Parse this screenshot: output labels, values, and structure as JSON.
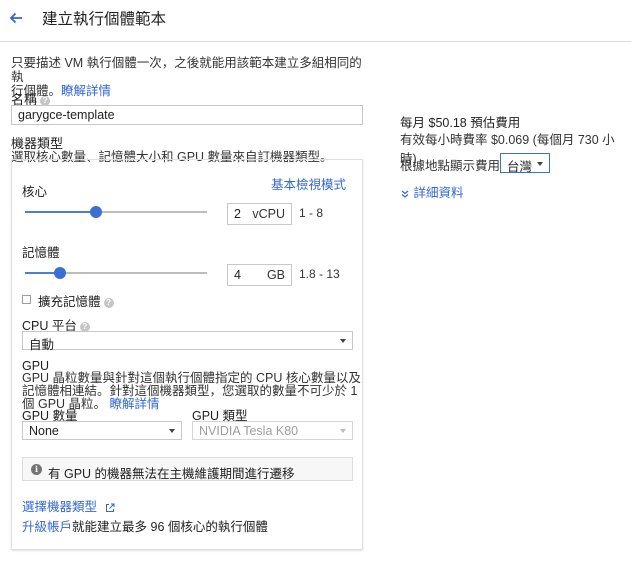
{
  "header": {
    "title": "建立執行個體範本"
  },
  "intro": {
    "text": "只要描述 VM 執行個體一次，之後就能用該範本建立多組相同的執行個體。",
    "text_line1": "只要描述 VM 執行個體一次，之後就能用該範本建立多組相同的執",
    "text_line2": "行個體。",
    "learn_more": "瞭解詳情"
  },
  "name": {
    "label": "名稱",
    "value": "garygce-template"
  },
  "machine_type": {
    "label": "機器類型",
    "description": "選取核心數量、記憶體大小和 GPU 數量來自訂機器類型。",
    "basic_view_link": "基本檢視模式",
    "cores": {
      "label": "核心",
      "value": "2",
      "unit": "vCPU",
      "range": "1 - 8",
      "slider_fraction": 0.39
    },
    "memory": {
      "label": "記憶體",
      "value": "4",
      "unit": "GB",
      "range": "1.8 - 13",
      "slider_fraction": 0.19
    },
    "extended_memory": {
      "label": "擴充記憶體",
      "checked": false
    },
    "cpu_platform": {
      "label": "CPU 平台",
      "selected": "自動"
    },
    "gpu": {
      "heading": "GPU",
      "description_line1": "GPU 晶粒數量與針對這個執行個體指定的 CPU 核心數量以及",
      "description_line2": "記憶體相連結。針對這個機器類型，您選取的數量不可少於 1",
      "description_line3": "個 GPU 晶粒。",
      "learn_more": "瞭解詳情",
      "count_label": "GPU 數量",
      "count_selected": "None",
      "type_label": "GPU 類型",
      "type_selected": "NVIDIA Tesla K80"
    },
    "info_message": "有 GPU 的機器無法在主機維護期間進行遷移",
    "select_machine_type_link": "選擇機器類型",
    "upgrade_link": "升級帳戶",
    "upgrade_text": "就能建立最多 96 個核心的執行個體"
  },
  "pricing": {
    "monthly_prefix": "每月",
    "monthly_amount": "$50.18",
    "monthly_suffix": "預估費用",
    "hourly": "有效每小時費率 $0.069 (每個月 730 小時)",
    "region_label": "根據地點顯示費用",
    "region_selected": "台灣",
    "details_link": "詳細資料"
  },
  "colors": {
    "accent": "#3367d6",
    "slider": "#3b6fd4"
  }
}
